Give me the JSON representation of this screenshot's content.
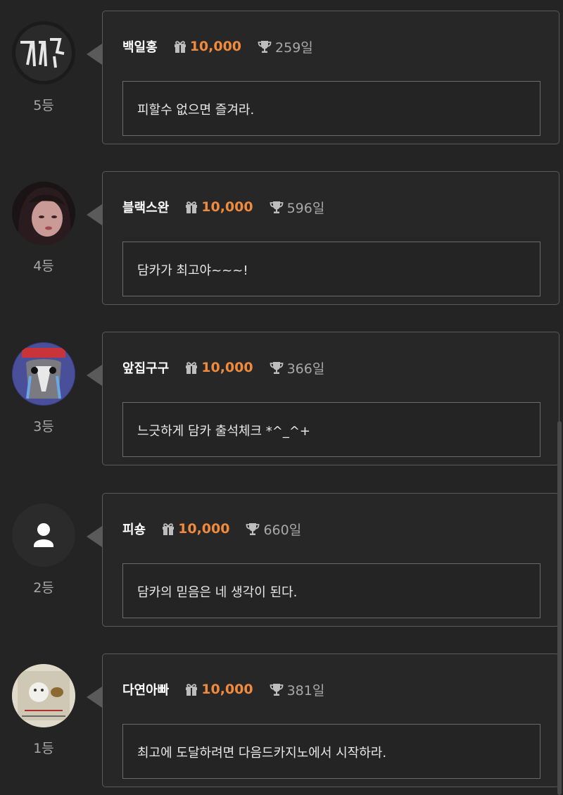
{
  "icons": {
    "gift": "gift-icon",
    "trophy": "trophy-icon",
    "default_avatar": "user-icon"
  },
  "colors": {
    "background": "#242424",
    "gift_amount": "#f08a3c",
    "name": "#ffffff",
    "secondary_text": "#a8a8a8",
    "border": "#5a5a5a"
  },
  "entries": [
    {
      "rank": "5등",
      "name": "백일홍",
      "gift": "10,000",
      "days": "259일",
      "message": "피할수 없으면 즐겨라."
    },
    {
      "rank": "4등",
      "name": "블랙스완",
      "gift": "10,000",
      "days": "596일",
      "message": "담카가 최고야~~~!"
    },
    {
      "rank": "3등",
      "name": "앞집구구",
      "gift": "10,000",
      "days": "366일",
      "message": "느긋하게 담카 출석체크 *^_^+"
    },
    {
      "rank": "2등",
      "name": "피숑",
      "gift": "10,000",
      "days": "660일",
      "message": "담카의 믿음은 네 생각이 된다."
    },
    {
      "rank": "1등",
      "name": "다연아빠",
      "gift": "10,000",
      "days": "381일",
      "message": "최고에 도달하려면 다음드카지노에서 시작하라."
    }
  ]
}
